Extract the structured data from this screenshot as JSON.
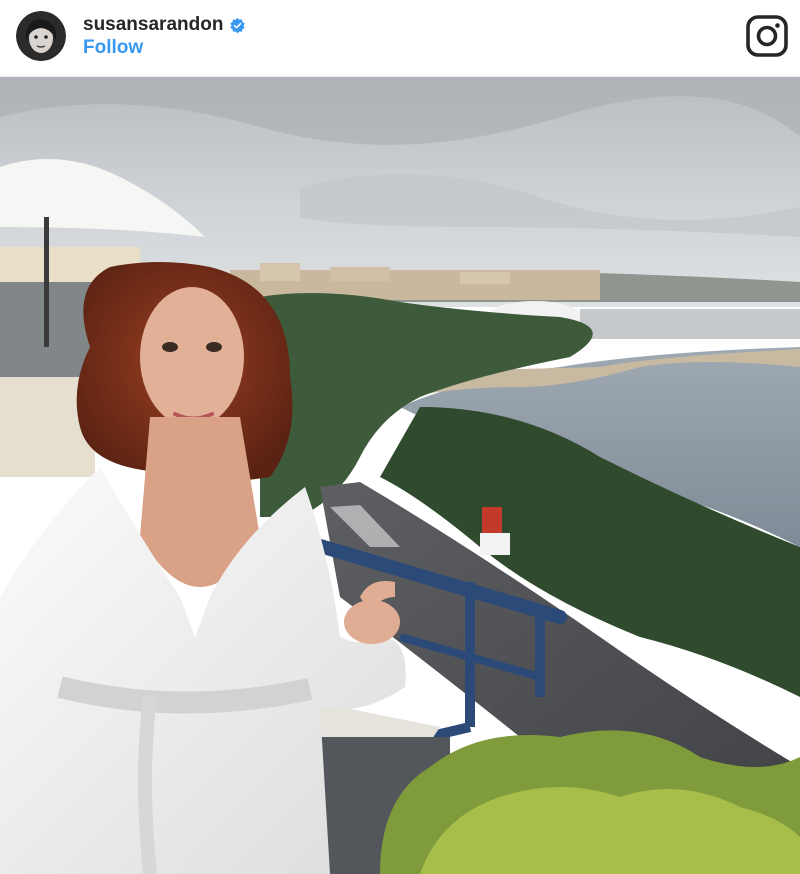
{
  "post": {
    "username": "susansarandon",
    "follow_label": "Follow",
    "verified_icon": "verified-badge-icon",
    "platform_icon": "instagram-icon"
  },
  "colors": {
    "follow_blue": "#3897f0",
    "verified_blue": "#3897f0",
    "username_text": "#262626"
  }
}
